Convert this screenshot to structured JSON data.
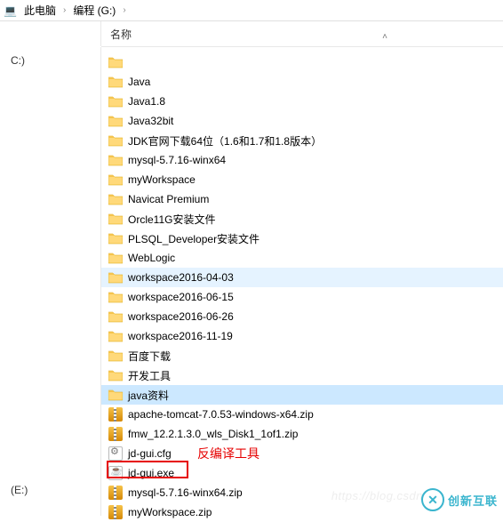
{
  "breadcrumb": {
    "items": [
      "此电脑",
      "编程 (G:)"
    ]
  },
  "columns": {
    "name": "名称"
  },
  "tree": {
    "drives": [
      "C:)",
      "(E:)"
    ]
  },
  "files": [
    {
      "icon": "folder",
      "name": "",
      "sel": ""
    },
    {
      "icon": "folder",
      "name": "Java",
      "sel": ""
    },
    {
      "icon": "folder",
      "name": "Java1.8",
      "sel": ""
    },
    {
      "icon": "folder",
      "name": "Java32bit",
      "sel": ""
    },
    {
      "icon": "folder",
      "name": "JDK官网下载64位（1.6和1.7和1.8版本）",
      "sel": ""
    },
    {
      "icon": "folder",
      "name": "mysql-5.7.16-winx64",
      "sel": ""
    },
    {
      "icon": "folder",
      "name": "myWorkspace",
      "sel": ""
    },
    {
      "icon": "folder",
      "name": "Navicat Premium",
      "sel": ""
    },
    {
      "icon": "folder",
      "name": "Orcle11G安装文件",
      "sel": ""
    },
    {
      "icon": "folder",
      "name": "PLSQL_Developer安装文件",
      "sel": ""
    },
    {
      "icon": "folder",
      "name": "WebLogic",
      "sel": ""
    },
    {
      "icon": "folder",
      "name": "workspace2016-04-03",
      "sel": "light"
    },
    {
      "icon": "folder",
      "name": "workspace2016-06-15",
      "sel": ""
    },
    {
      "icon": "folder",
      "name": "workspace2016-06-26",
      "sel": ""
    },
    {
      "icon": "folder",
      "name": "workspace2016-11-19",
      "sel": ""
    },
    {
      "icon": "folder",
      "name": "百度下载",
      "sel": ""
    },
    {
      "icon": "folder",
      "name": "开发工具",
      "sel": ""
    },
    {
      "icon": "folder",
      "name": "java资料",
      "sel": "strong"
    },
    {
      "icon": "zip",
      "name": "apache-tomcat-7.0.53-windows-x64.zip",
      "sel": ""
    },
    {
      "icon": "zip",
      "name": "fmw_12.2.1.3.0_wls_Disk1_1of1.zip",
      "sel": ""
    },
    {
      "icon": "cfg",
      "name": "jd-gui.cfg",
      "sel": ""
    },
    {
      "icon": "exe",
      "name": "jd-gui.exe",
      "sel": "",
      "highlight": true
    },
    {
      "icon": "zip",
      "name": "mysql-5.7.16-winx64.zip",
      "sel": ""
    },
    {
      "icon": "zip",
      "name": "myWorkspace.zip",
      "sel": ""
    }
  ],
  "annotation": {
    "text": "反编译工具"
  },
  "watermark": {
    "brand": "创新互联",
    "csdn": "https://blog.csdn"
  }
}
